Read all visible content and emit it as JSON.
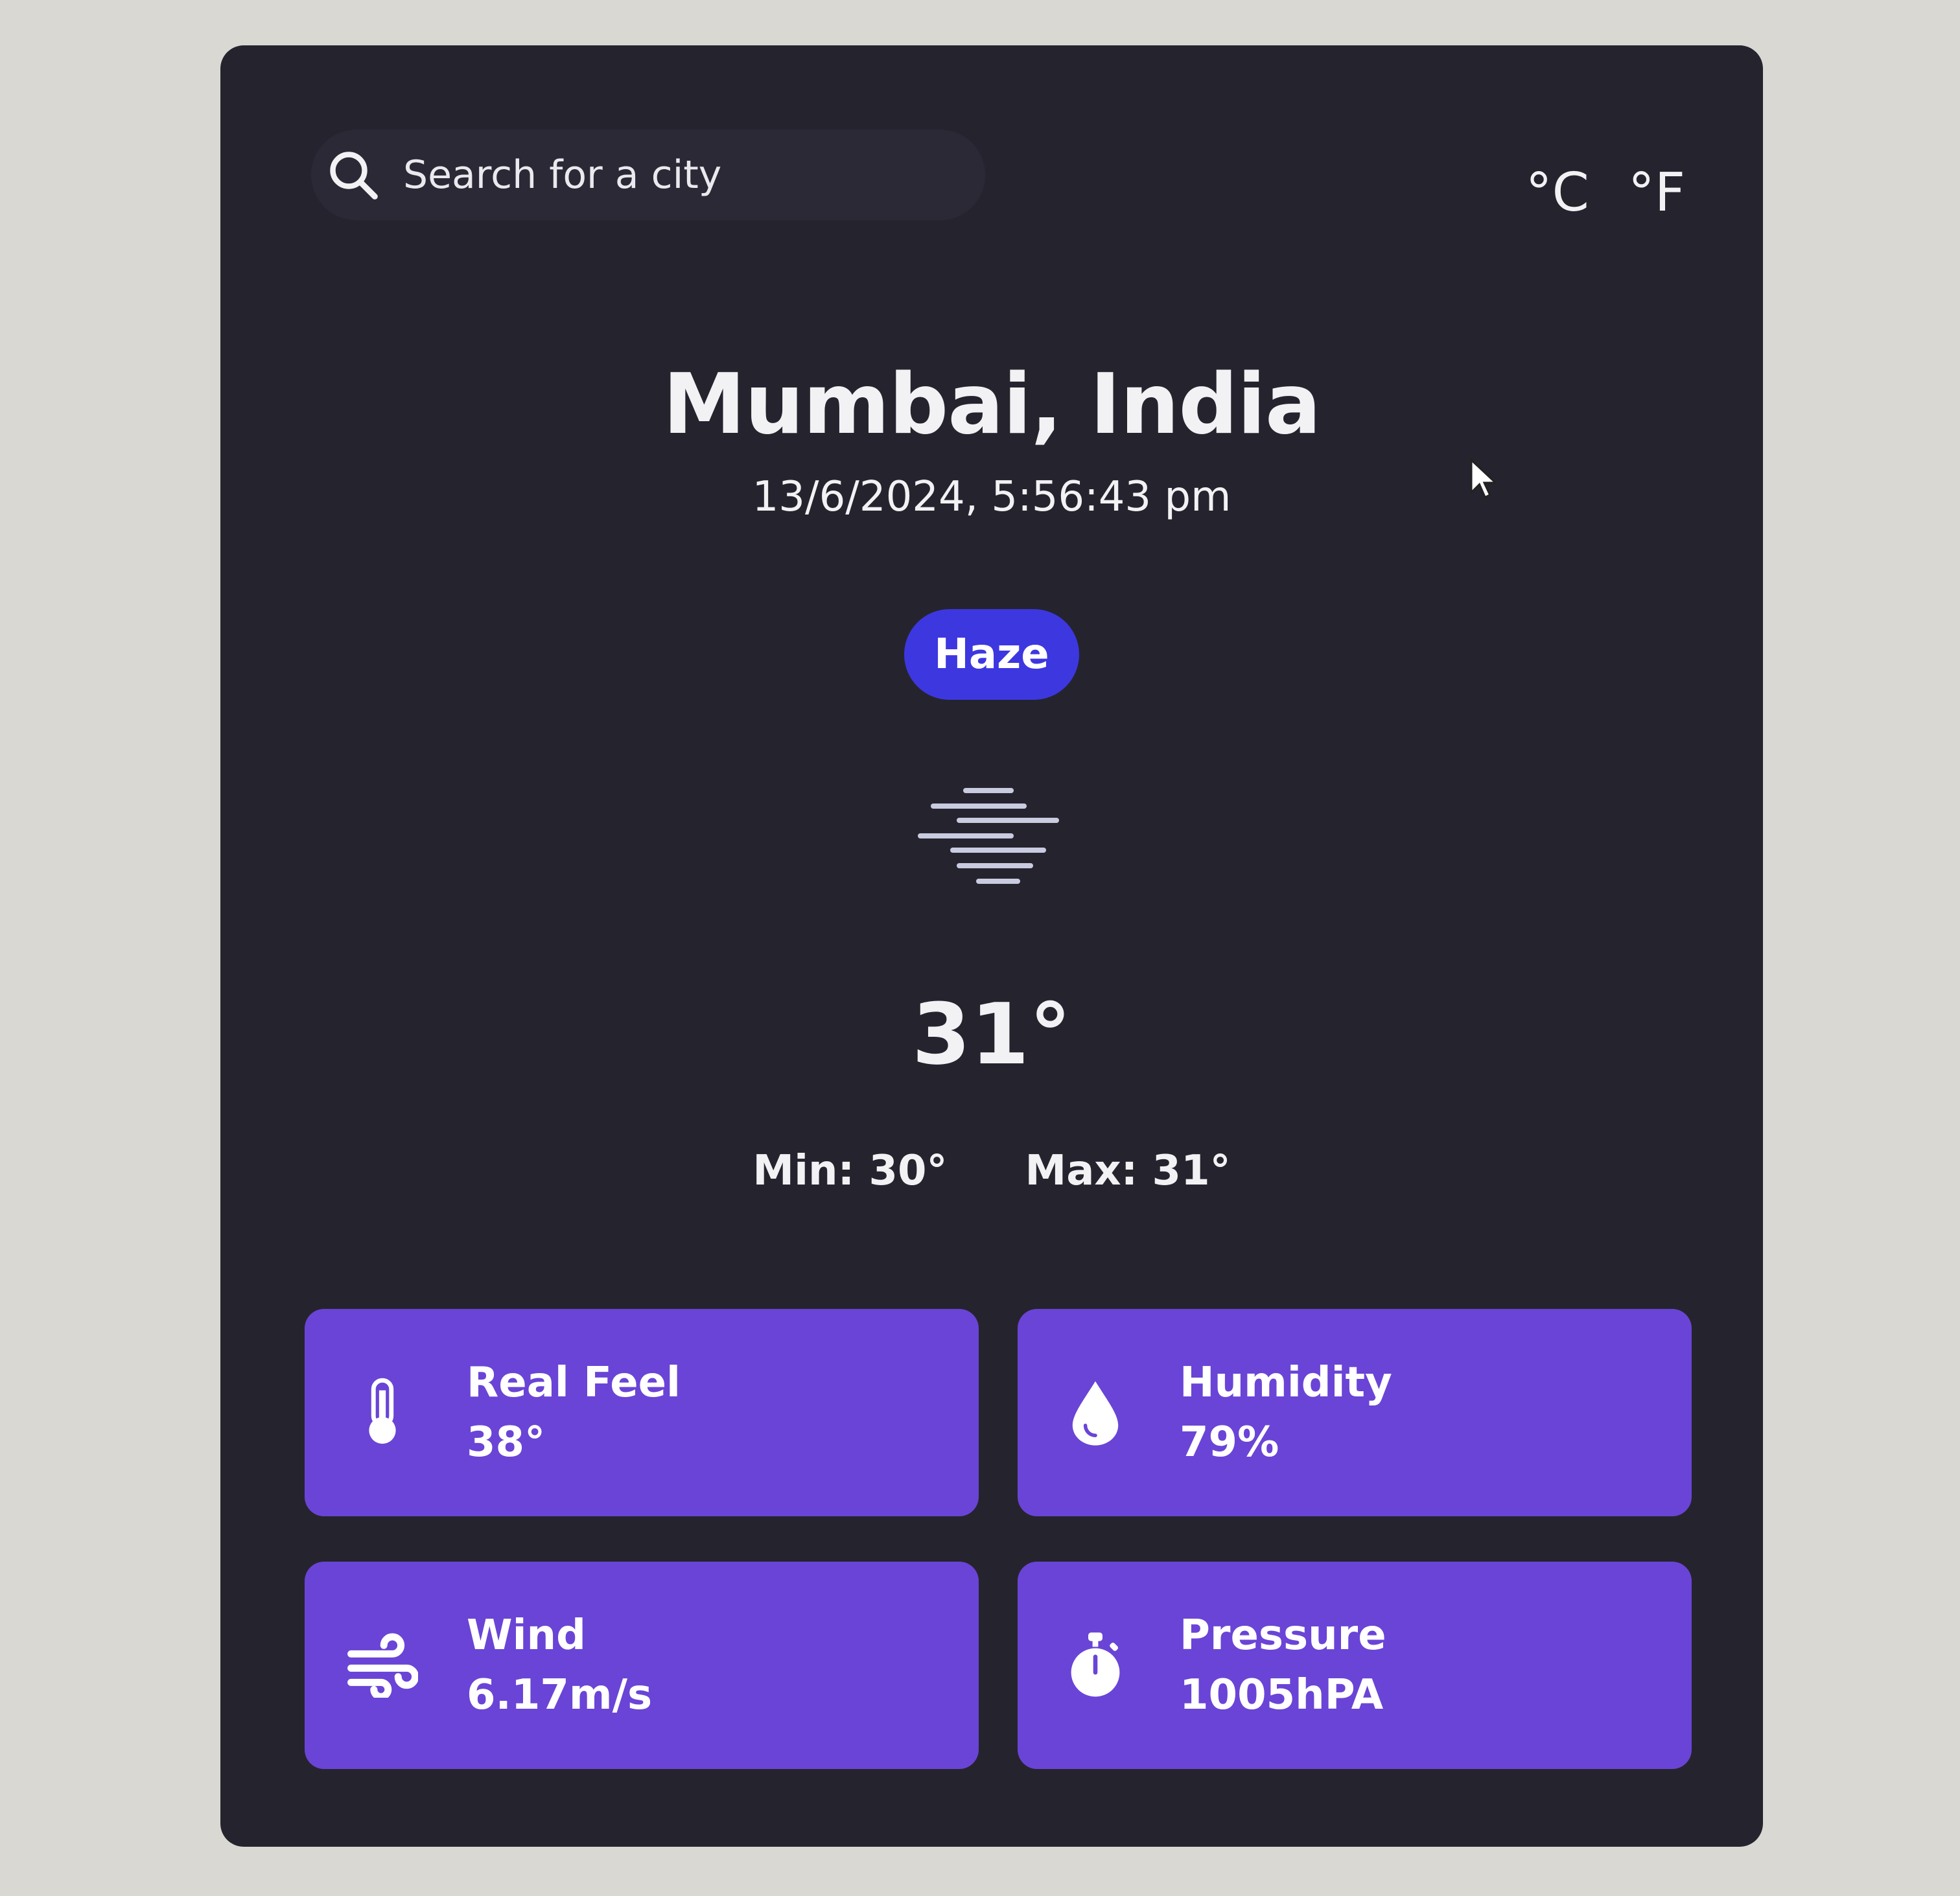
{
  "search": {
    "placeholder": "Search for a city"
  },
  "units": {
    "celsius": "°C",
    "fahrenheit": "°F"
  },
  "location": {
    "name": "Mumbai, India",
    "datetime": "13/6/2024, 5:56:43 pm"
  },
  "condition": {
    "label": "Haze",
    "icon": "haze-icon"
  },
  "temperature": {
    "current": "31°",
    "min": "Min: 30°",
    "max": "Max: 31°"
  },
  "details": [
    {
      "icon": "thermometer-icon",
      "label": "Real Feel",
      "value": "38°"
    },
    {
      "icon": "droplet-icon",
      "label": "Humidity",
      "value": "79%"
    },
    {
      "icon": "wind-icon",
      "label": "Wind",
      "value": "6.17m/s"
    },
    {
      "icon": "stopwatch-icon",
      "label": "Pressure",
      "value": "1005hPA"
    }
  ],
  "colors": {
    "card_background": "#25242e",
    "badge": "#3d37e0",
    "tile": "#6a44d6",
    "text": "#f2f2f4"
  }
}
